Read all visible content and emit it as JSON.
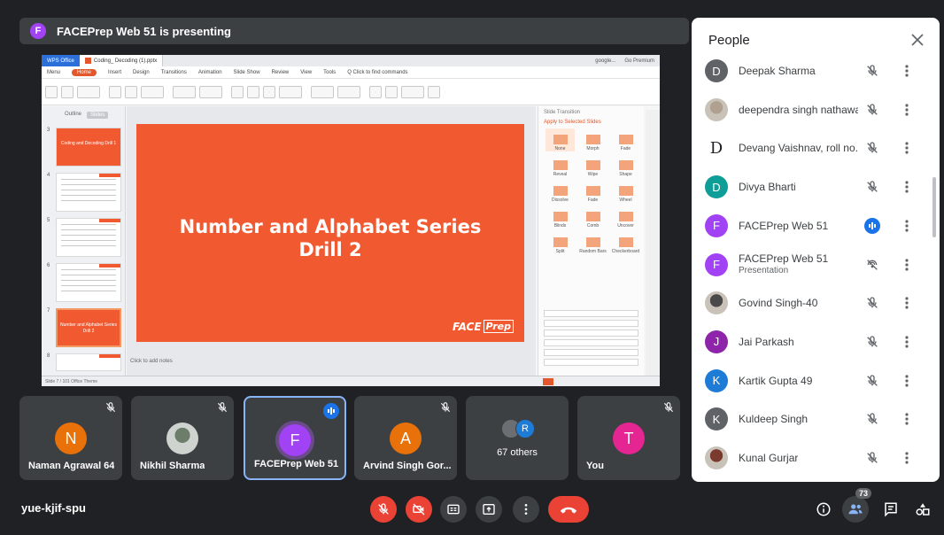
{
  "presenter_bar": {
    "avatar_letter": "F",
    "text": "FACEPrep Web 51 is presenting"
  },
  "shared_screen": {
    "app_tab": "WPS Office",
    "doc_tab": "Coding_ Decoding (1).pptx",
    "right_items": [
      "google...",
      "Go Premium"
    ],
    "menu": [
      "Menu",
      "Home",
      "Insert",
      "Design",
      "Transitions",
      "Animation",
      "Slide Show",
      "Review",
      "View",
      "Tools",
      "Q Click to find commands"
    ],
    "outline_tabs": [
      "Outline",
      "Slides"
    ],
    "thumbs": [
      {
        "num": "3",
        "title": "Coding and Decoding Drill 1"
      },
      {
        "num": "4",
        "title": ""
      },
      {
        "num": "5",
        "title": ""
      },
      {
        "num": "6",
        "title": ""
      },
      {
        "num": "7",
        "title": "Number and Alphabet Series Drill 2"
      },
      {
        "num": "8",
        "title": ""
      }
    ],
    "slide_title_line1": "Number and Alphabet Series",
    "slide_title_line2": "Drill 2",
    "logo_face": "FACE",
    "logo_prep": "Prep",
    "notes": "Click to add notes",
    "pane": {
      "header": "Slide Transition",
      "subheader": "Apply to Selected Slides",
      "transitions": [
        "None",
        "Morph",
        "Fade",
        "Reveal",
        "Wipe",
        "Shape",
        "Dissolve",
        "Fade",
        "Wheel",
        "Blinds",
        "Comb",
        "Uncover",
        "Split",
        "Random Bars",
        "Checkerboard"
      ]
    },
    "status": "Slide 7 / 101    Office Theme"
  },
  "tiles": [
    {
      "name": "Naman Agrawal 64",
      "letter": "N",
      "color": "#e8710a",
      "muted": true
    },
    {
      "name": "Nikhil Sharma",
      "letter": "",
      "color": "#cfd3cf",
      "muted": true
    },
    {
      "name": "FACEPrep Web 51",
      "letter": "F",
      "color": "#a142f4",
      "talking": true
    },
    {
      "name": "Arvind Singh Gor...",
      "letter": "A",
      "color": "#e8710a",
      "muted": true
    },
    {
      "name": "",
      "others": "67 others",
      "second_letter": "R"
    },
    {
      "name": "You",
      "letter": "T",
      "color": "#e52592",
      "muted": true
    }
  ],
  "meeting_code": "yue-kjif-spu",
  "people_count": "73",
  "people_panel": {
    "title": "People",
    "participants": [
      {
        "name": "Deepak Sharma",
        "letter": "D",
        "color": "#5f6368",
        "status": "muted"
      },
      {
        "name": "deependra singh nathawat",
        "letter": "",
        "color": "#b0a090",
        "status": "muted"
      },
      {
        "name": "Devang Vaishnav, roll no.-...",
        "letter": "D",
        "color": "letter",
        "status": "muted"
      },
      {
        "name": "Divya Bharti",
        "letter": "D",
        "color": "#0f9d98",
        "status": "muted"
      },
      {
        "name": "FACEPrep Web 51",
        "letter": "F",
        "color": "#a142f4",
        "status": "talking"
      },
      {
        "name": "FACEPrep Web 51",
        "sub": "Presentation",
        "letter": "F",
        "color": "#a142f4",
        "status": "presenting"
      },
      {
        "name": "Govind Singh-40",
        "letter": "",
        "color": "#4a4a4a",
        "status": "muted"
      },
      {
        "name": "Jai Parkash",
        "letter": "J",
        "color": "#8e24aa",
        "status": "muted"
      },
      {
        "name": "Kartik Gupta 49",
        "letter": "K",
        "color": "#1e7bd6",
        "status": "muted"
      },
      {
        "name": "Kuldeep Singh",
        "letter": "K",
        "color": "#5f6368",
        "status": "muted"
      },
      {
        "name": "Kunal Gurjar",
        "letter": "",
        "color": "#7a3b2e",
        "status": "muted"
      }
    ]
  }
}
